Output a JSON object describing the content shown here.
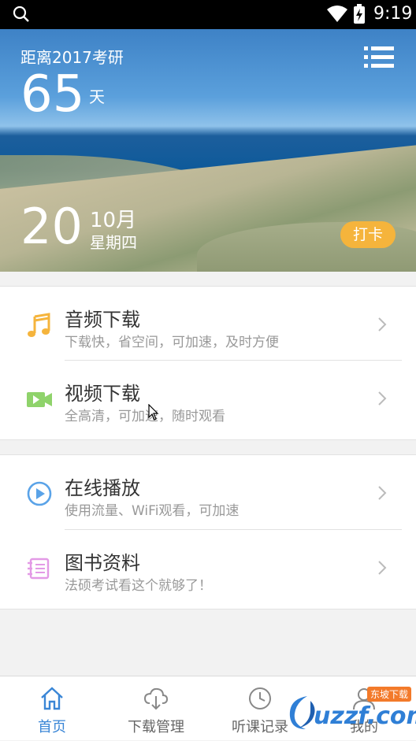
{
  "status_bar": {
    "time": "9:19"
  },
  "hero": {
    "countdown_label": "距离2017考研",
    "days": "65",
    "days_unit": "天",
    "date_day": "20",
    "date_month": "10月",
    "date_weekday": "星期四",
    "checkin_label": "打卡"
  },
  "menu_group_1": [
    {
      "title": "音频下载",
      "subtitle": "下载快，省空间，可加速，及时方便",
      "icon": "music-note-icon",
      "color": "#f5b43c"
    },
    {
      "title": "视频下载",
      "subtitle": "全高清，可加速，随时观看",
      "icon": "video-camera-icon",
      "color": "#8fd36b"
    }
  ],
  "menu_group_2": [
    {
      "title": "在线播放",
      "subtitle": "使用流量、WiFi观看，可加速",
      "icon": "play-circle-icon",
      "color": "#5aa3e8"
    },
    {
      "title": "图书资料",
      "subtitle": "法硕考试看这个就够了！",
      "icon": "book-icon",
      "color": "#e39ae6"
    }
  ],
  "tab_bar": [
    {
      "label": "首页",
      "icon": "home-icon",
      "active": true
    },
    {
      "label": "下载管理",
      "icon": "cloud-download-icon",
      "active": false
    },
    {
      "label": "听课记录",
      "icon": "clock-icon",
      "active": false
    },
    {
      "label": "我的",
      "icon": "user-icon",
      "active": false
    }
  ],
  "watermark": {
    "logo_text": "uzzf.com",
    "badge": "东坡下载"
  },
  "colors": {
    "accent": "#3a86d6",
    "checkin": "#f5b43c"
  }
}
